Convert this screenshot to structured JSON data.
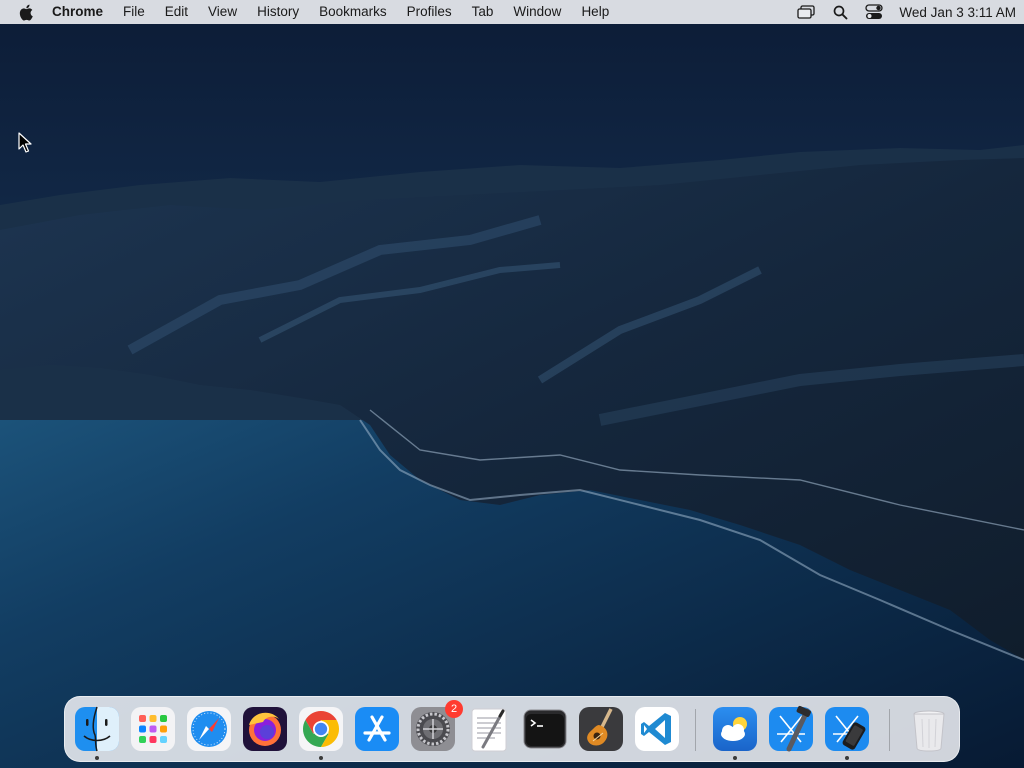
{
  "menubar": {
    "app_name": "Chrome",
    "items": [
      "File",
      "Edit",
      "View",
      "History",
      "Bookmarks",
      "Profiles",
      "Tab",
      "Window",
      "Help"
    ],
    "clock": "Wed Jan 3  3:11 AM"
  },
  "dock": {
    "apps": [
      {
        "name": "Finder",
        "icon": "finder-icon",
        "running": true
      },
      {
        "name": "Launchpad",
        "icon": "launchpad-icon",
        "running": false
      },
      {
        "name": "Safari",
        "icon": "safari-icon",
        "running": false
      },
      {
        "name": "Firefox",
        "icon": "firefox-icon",
        "running": false
      },
      {
        "name": "Google Chrome",
        "icon": "chrome-icon",
        "running": true
      },
      {
        "name": "App Store",
        "icon": "app-store-icon",
        "running": false
      },
      {
        "name": "System Settings",
        "icon": "system-settings-icon",
        "running": false,
        "badge": "2"
      },
      {
        "name": "TextEdit",
        "icon": "textedit-icon",
        "running": false
      },
      {
        "name": "Terminal",
        "icon": "terminal-icon",
        "running": false
      },
      {
        "name": "GarageBand",
        "icon": "garageband-icon",
        "running": false
      },
      {
        "name": "Visual Studio Code",
        "icon": "vscode-icon",
        "running": false
      },
      {
        "name": "Weather",
        "icon": "weather-icon",
        "running": true
      },
      {
        "name": "Xcode",
        "icon": "xcode-icon",
        "running": false
      },
      {
        "name": "Simulator",
        "icon": "simulator-icon",
        "running": true
      },
      {
        "name": "Trash",
        "icon": "trash-icon",
        "running": false
      }
    ]
  }
}
